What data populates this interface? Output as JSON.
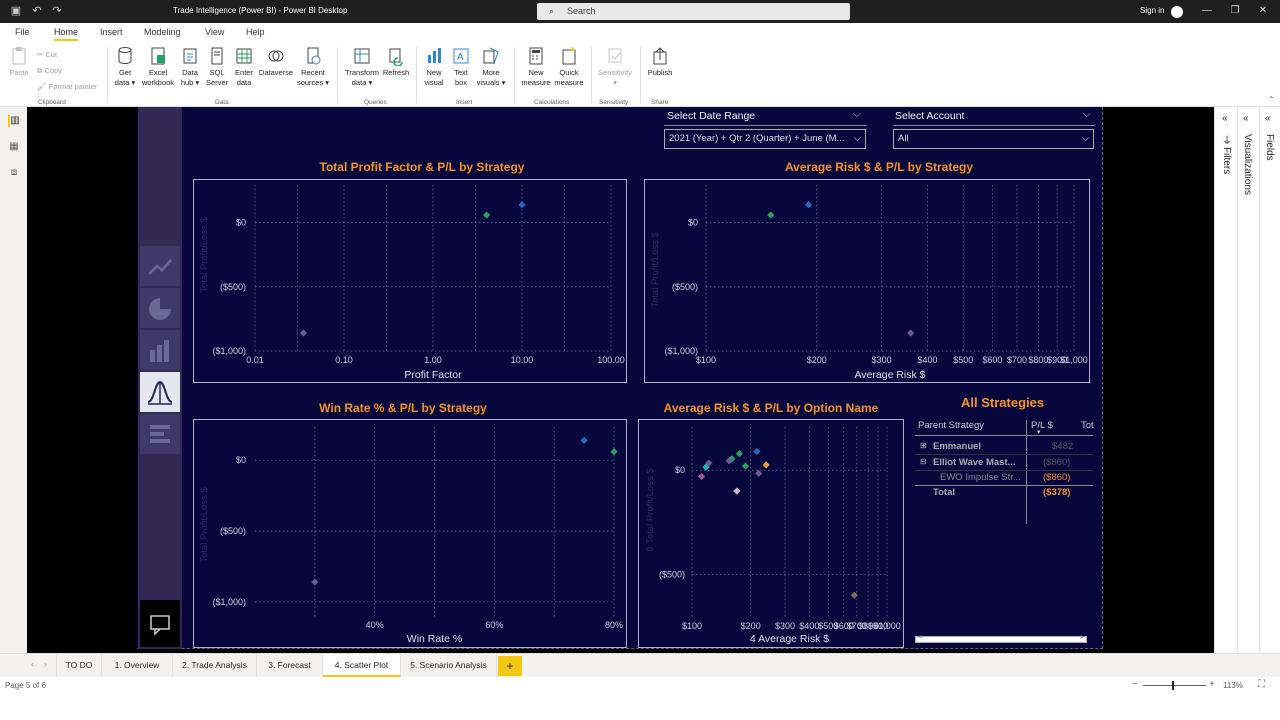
{
  "window": {
    "title": "Trade Intelligence (Power BI) - Power BI Desktop",
    "search_placeholder": "Search",
    "sign_in": "Sign in"
  },
  "menu": {
    "tabs": [
      "File",
      "Home",
      "Insert",
      "Modeling",
      "View",
      "Help"
    ],
    "active": "Home"
  },
  "ribbon": {
    "paste": "Paste",
    "cut": "Cut",
    "copy": "Copy",
    "format_painter": "Format painter",
    "get_data": [
      "Get",
      "data ▾"
    ],
    "excel": [
      "Excel",
      "workbook"
    ],
    "data_hub": [
      "Data",
      "hub ▾"
    ],
    "sql": [
      "SQL",
      "Server"
    ],
    "enter": [
      "Enter",
      "data"
    ],
    "dataverse": [
      "Dataverse",
      ""
    ],
    "recent": [
      "Recent",
      "sources ▾"
    ],
    "transform": [
      "Transform",
      "data ▾"
    ],
    "refresh": [
      "Refresh",
      ""
    ],
    "new_visual": [
      "New",
      "visual"
    ],
    "text_box": [
      "Text",
      "box"
    ],
    "more_visuals": [
      "More",
      "visuals ▾"
    ],
    "new_measure": [
      "New",
      "measure"
    ],
    "quick_measure": [
      "Quick",
      "measure"
    ],
    "sensitivity": [
      "Sensitivity",
      "▾"
    ],
    "publish": [
      "Publish",
      ""
    ],
    "groups": {
      "clipboard": "Clipboard",
      "data": "Data",
      "queries": "Queries",
      "insert": "Insert",
      "calculations": "Calculations",
      "sensitivity": "Sensitivity",
      "share": "Share"
    }
  },
  "slicers": {
    "date_label": "Select Date Range",
    "date_value": "2021 (Year) + Qtr 2 (Quarter) + June (M...",
    "account_label": "Select Account",
    "account_value": "All"
  },
  "charts": {
    "c1": {
      "title": "Total Profit Factor & P/L by Strategy",
      "ylabel": "Total Profit/Loss $",
      "xlabel": "Profit Factor",
      "yticks": [
        "$0",
        "($500)",
        "($1,000)"
      ],
      "xticks": [
        "0.01",
        "0.10",
        "1.00",
        "10.00",
        "100.00"
      ]
    },
    "c2": {
      "title": "Average Risk $ & P/L by Strategy",
      "ylabel": "Total Profit/Loss $",
      "xlabel": "Average Risk $",
      "yticks": [
        "$0",
        "($500)",
        "($1,000)"
      ],
      "xticks": [
        "$100",
        "$200",
        "$300",
        "$400",
        "$500",
        "$600",
        "$700",
        "$800",
        "$900",
        "$1,000"
      ]
    },
    "c3": {
      "title": "Win Rate % & P/L by Strategy",
      "ylabel": "Total Profit/Loss $",
      "xlabel": "Win Rate %",
      "yticks": [
        "$0",
        "($500)",
        "($1,000)"
      ],
      "xticks": [
        "40%",
        "60%",
        "80%"
      ]
    },
    "c4": {
      "title": "Average Risk $ & P/L by Option Name",
      "ylabel": "0 Total Profit/Loss $",
      "xlabel": "4 Average Risk $",
      "yticks": [
        "$0",
        "($500)"
      ],
      "xticks": [
        "$100",
        "$200",
        "$300",
        "$400",
        "$500",
        "$600",
        "$700",
        "$800",
        "$900",
        "$1,000"
      ]
    }
  },
  "chart_data": [
    {
      "type": "scatter",
      "title": "Total Profit Factor & P/L by Strategy",
      "xlabel": "Profit Factor",
      "ylabel": "Total Profit/Loss $",
      "xscale": "log",
      "xlim": [
        0.01,
        100
      ],
      "ylim": [
        -1000,
        200
      ],
      "series": [
        {
          "name": "",
          "color": "#1f6fc0",
          "x": [
            10
          ],
          "y": [
            140
          ]
        },
        {
          "name": "",
          "color": "#21a366",
          "x": [
            4
          ],
          "y": [
            60
          ]
        },
        {
          "name": "",
          "color": "#6b5b95",
          "x": [
            0.035
          ],
          "y": [
            -860
          ]
        }
      ]
    },
    {
      "type": "scatter",
      "title": "Average Risk $ & P/L by Strategy",
      "xlabel": "Average Risk $",
      "ylabel": "Total Profit/Loss $",
      "xscale": "log",
      "xlim": [
        100,
        1000
      ],
      "ylim": [
        -1000,
        200
      ],
      "series": [
        {
          "name": "",
          "color": "#1f6fc0",
          "x": [
            190
          ],
          "y": [
            140
          ]
        },
        {
          "name": "",
          "color": "#21a366",
          "x": [
            150
          ],
          "y": [
            60
          ]
        },
        {
          "name": "",
          "color": "#6b5b95",
          "x": [
            360
          ],
          "y": [
            -860
          ]
        }
      ]
    },
    {
      "type": "scatter",
      "title": "Win Rate % & P/L by Strategy",
      "xlabel": "Win Rate %",
      "ylabel": "Total Profit/Loss $",
      "xlim": [
        0.2,
        0.8
      ],
      "ylim": [
        -1100,
        150
      ],
      "series": [
        {
          "name": "",
          "color": "#1f6fc0",
          "x": [
            0.75
          ],
          "y": [
            140
          ]
        },
        {
          "name": "",
          "color": "#21a366",
          "x": [
            0.8
          ],
          "y": [
            60
          ]
        },
        {
          "name": "",
          "color": "#6b5b95",
          "x": [
            0.3
          ],
          "y": [
            -860
          ]
        }
      ]
    },
    {
      "type": "scatter",
      "title": "Average Risk $ & P/L by Option Name",
      "xlabel": "4 Average Risk $",
      "ylabel": "0 Total Profit/Loss $",
      "xscale": "log",
      "xlim": [
        100,
        1000
      ],
      "ylim": [
        -700,
        150
      ],
      "series": [
        {
          "name": "",
          "color": "#1f6fc0",
          "x": [
            215
          ],
          "y": [
            90
          ]
        },
        {
          "name": "",
          "color": "#21a366",
          "x": [
            175
          ],
          "y": [
            80
          ]
        },
        {
          "name": "",
          "color": "#21a366",
          "x": [
            160
          ],
          "y": [
            55
          ]
        },
        {
          "name": "",
          "color": "#21a366",
          "x": [
            188
          ],
          "y": [
            20
          ]
        },
        {
          "name": "",
          "color": "#20b2aa",
          "x": [
            118
          ],
          "y": [
            15
          ]
        },
        {
          "name": "",
          "color": "#6b5b95",
          "x": [
            122
          ],
          "y": [
            35
          ]
        },
        {
          "name": "",
          "color": "#6b5b95",
          "x": [
            220
          ],
          "y": [
            -15
          ]
        },
        {
          "name": "",
          "color": "#a05c8c",
          "x": [
            112
          ],
          "y": [
            -30
          ]
        },
        {
          "name": "",
          "color": "#e09a3a",
          "x": [
            240
          ],
          "y": [
            25
          ]
        },
        {
          "name": "",
          "color": "#d8b4c8",
          "x": [
            170
          ],
          "y": [
            -100
          ]
        },
        {
          "name": "",
          "color": "#6b5b95",
          "x": [
            155
          ],
          "y": [
            45
          ]
        },
        {
          "name": "",
          "color": "#7d6b5b",
          "x": [
            680
          ],
          "y": [
            -600
          ]
        }
      ]
    }
  ],
  "matrix": {
    "title": "All Strategies",
    "headers": [
      "Parent Strategy",
      "P/L $",
      "Tot"
    ],
    "rows": [
      {
        "label": "Emmanuel",
        "value": "$482"
      },
      {
        "label": "Elliot Wave Mast...",
        "value": "($860)"
      },
      {
        "label": "EWO Impulse Str...",
        "value": "($860)"
      },
      {
        "label": "Total",
        "value": "($378)"
      }
    ]
  },
  "right_panes": [
    "Filters",
    "Visualizations",
    "Fields"
  ],
  "pages": {
    "tabs": [
      "TO DO",
      "1. Overview",
      "2. Trade Analysis",
      "3. Forecast",
      "4. Scatter Plot",
      "5. Scenario Analysis"
    ],
    "active": "4. Scatter Plot",
    "add": "+"
  },
  "status": {
    "page": "Page 5 of 6",
    "zoom": "113%"
  },
  "colors": {
    "accent": "#f2c811",
    "title": "#f7941d",
    "background": "#07073e"
  }
}
